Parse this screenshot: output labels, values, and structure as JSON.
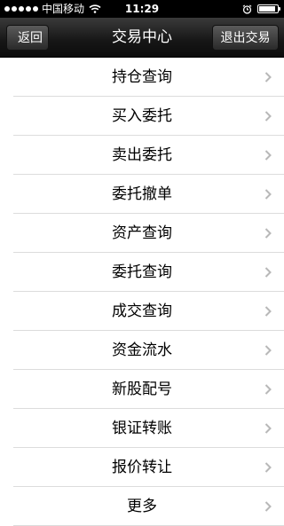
{
  "status": {
    "carrier": "中国移动",
    "time": "11:29",
    "signal_dots_filled": 5,
    "battery_level": 0.9
  },
  "nav": {
    "back_label": "返回",
    "title": "交易中心",
    "exit_label": "退出交易"
  },
  "menu": {
    "items": [
      {
        "label": "持仓查询"
      },
      {
        "label": "买入委托"
      },
      {
        "label": "卖出委托"
      },
      {
        "label": "委托撤单"
      },
      {
        "label": "资产查询"
      },
      {
        "label": "委托查询"
      },
      {
        "label": "成交查询"
      },
      {
        "label": "资金流水"
      },
      {
        "label": "新股配号"
      },
      {
        "label": "银证转账"
      },
      {
        "label": "报价转让"
      },
      {
        "label": "更多"
      }
    ]
  },
  "icons": {
    "chevron": "chevron-right-icon",
    "wifi": "wifi-icon",
    "alarm": "alarm-icon",
    "battery": "battery-icon"
  },
  "colors": {
    "navbar": "#161616",
    "divider": "#dcdcdc",
    "chevron": "#b8b8b8"
  }
}
